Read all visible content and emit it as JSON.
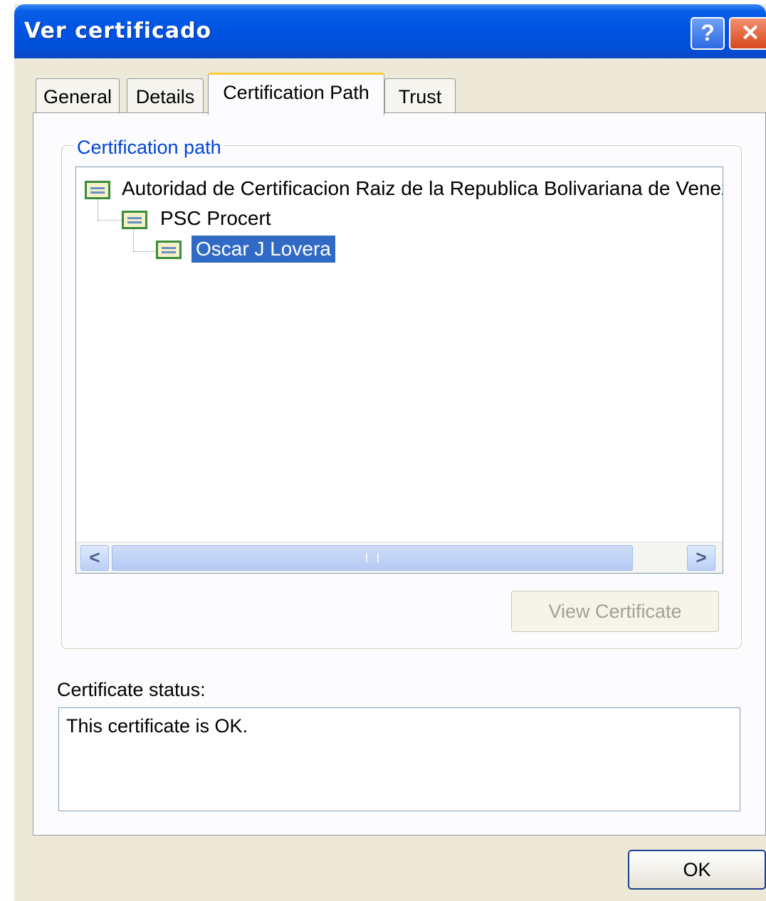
{
  "window": {
    "title": "Ver certificado",
    "help_glyph": "?",
    "close_glyph": "✕"
  },
  "tabs": [
    {
      "label": "General",
      "active": false
    },
    {
      "label": "Details",
      "active": false
    },
    {
      "label": "Certification Path",
      "active": true
    },
    {
      "label": "Trust",
      "active": false
    }
  ],
  "certification_path": {
    "group_label": "Certification path",
    "nodes": [
      {
        "label": "Autoridad de Certificacion Raiz de la Republica Bolivariana de Venezuela",
        "icon": "certificate-icon",
        "level": 0,
        "selected": false
      },
      {
        "label": "PSC Procert",
        "icon": "certificate-icon",
        "level": 1,
        "selected": false
      },
      {
        "label": "Oscar J Lovera",
        "icon": "certificate-icon",
        "level": 2,
        "selected": true
      }
    ],
    "scroll_left_glyph": "<",
    "scroll_right_glyph": ">",
    "view_button": {
      "label": "View Certificate",
      "enabled": false
    }
  },
  "status": {
    "label": "Certificate status:",
    "text": "This certificate is OK."
  },
  "ok_button": {
    "label": "OK"
  },
  "colors": {
    "titlebar": "#0054e3",
    "selection": "#316ac5",
    "group_label": "#0046d5",
    "active_tab_accent": "#ffc83c"
  }
}
